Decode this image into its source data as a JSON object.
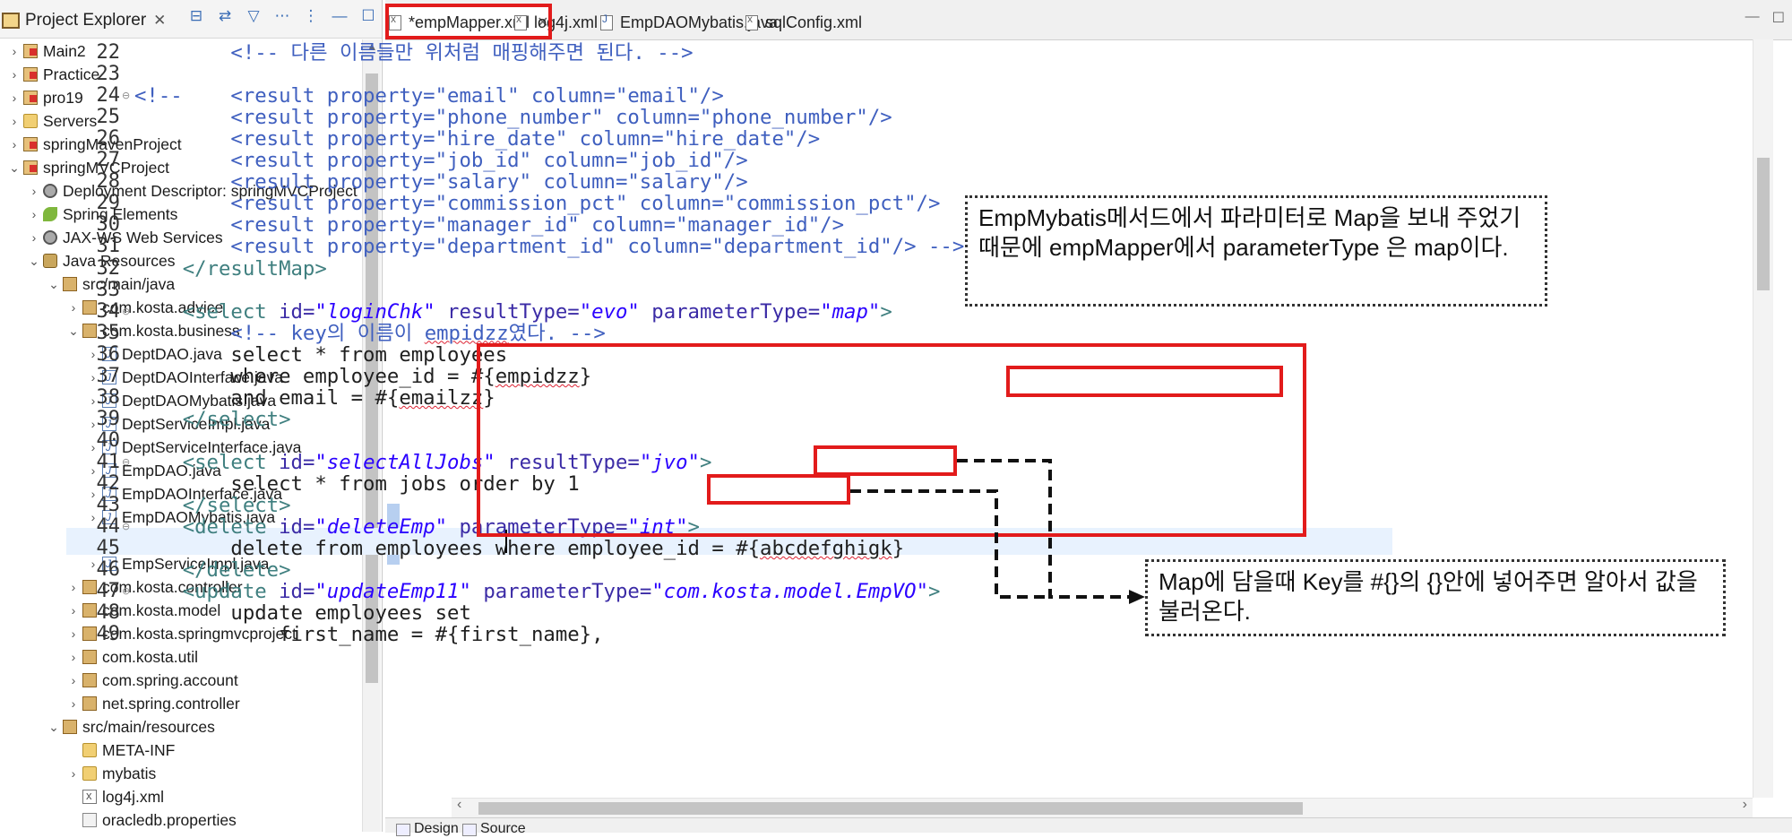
{
  "explorer": {
    "title": "Project Explorer",
    "close": "✕",
    "tools": [
      "⊟",
      "⇄",
      "▽",
      "⋯",
      "⋮",
      "—",
      "☐"
    ],
    "items": [
      {
        "label": "Main2",
        "level": 0,
        "arrow": "›",
        "icon": "project"
      },
      {
        "label": "Practice",
        "level": 0,
        "arrow": "›",
        "icon": "project"
      },
      {
        "label": "pro19",
        "level": 0,
        "arrow": "›",
        "icon": "project"
      },
      {
        "label": "Servers",
        "level": 0,
        "arrow": "›",
        "icon": "folder"
      },
      {
        "label": "springMavenProject",
        "level": 0,
        "arrow": "›",
        "icon": "project"
      },
      {
        "label": "springMVCProject",
        "level": 0,
        "arrow": "⌄",
        "icon": "project"
      },
      {
        "label": "Deployment Descriptor: springMVCProject",
        "level": 1,
        "arrow": "›",
        "icon": "gear"
      },
      {
        "label": "Spring Elements",
        "level": 1,
        "arrow": "›",
        "icon": "leaf"
      },
      {
        "label": "JAX-WS Web Services",
        "level": 1,
        "arrow": "›",
        "icon": "gear"
      },
      {
        "label": "Java Resources",
        "level": 1,
        "arrow": "⌄",
        "icon": "jar"
      },
      {
        "label": "src/main/java",
        "level": 2,
        "arrow": "⌄",
        "icon": "pkg"
      },
      {
        "label": "com.kosta.advice",
        "level": 3,
        "arrow": "›",
        "icon": "pkg"
      },
      {
        "label": "com.kosta.business",
        "level": 3,
        "arrow": "⌄",
        "icon": "pkg"
      },
      {
        "label": "DeptDAO.java",
        "level": 4,
        "arrow": "›",
        "icon": "java"
      },
      {
        "label": "DeptDAOInterface.java",
        "level": 4,
        "arrow": "›",
        "icon": "java"
      },
      {
        "label": "DeptDAOMybatis.java",
        "level": 4,
        "arrow": "›",
        "icon": "java"
      },
      {
        "label": "DeptServiceImpl.java",
        "level": 4,
        "arrow": "›",
        "icon": "java"
      },
      {
        "label": "DeptServiceInterface.java",
        "level": 4,
        "arrow": "›",
        "icon": "java"
      },
      {
        "label": "EmpDAO.java",
        "level": 4,
        "arrow": "›",
        "icon": "java"
      },
      {
        "label": "EmpDAOInterface.java",
        "level": 4,
        "arrow": "›",
        "icon": "java"
      },
      {
        "label": "EmpDAOMybatis.java",
        "level": 4,
        "arrow": "›",
        "icon": "java"
      },
      {
        "label": "EmpService.java",
        "level": 4,
        "arrow": "›",
        "icon": "java"
      },
      {
        "label": "EmpServiceImpl.java",
        "level": 4,
        "arrow": "›",
        "icon": "java"
      },
      {
        "label": "com.kosta.controller",
        "level": 3,
        "arrow": "›",
        "icon": "pkg"
      },
      {
        "label": "com.kosta.model",
        "level": 3,
        "arrow": "›",
        "icon": "pkg"
      },
      {
        "label": "com.kosta.springmvcproject",
        "level": 3,
        "arrow": "›",
        "icon": "pkg"
      },
      {
        "label": "com.kosta.util",
        "level": 3,
        "arrow": "›",
        "icon": "pkg"
      },
      {
        "label": "com.spring.account",
        "level": 3,
        "arrow": "›",
        "icon": "pkg"
      },
      {
        "label": "net.spring.controller",
        "level": 3,
        "arrow": "›",
        "icon": "pkg"
      },
      {
        "label": "src/main/resources",
        "level": 2,
        "arrow": "⌄",
        "icon": "pkg"
      },
      {
        "label": "META-INF",
        "level": 3,
        "arrow": "",
        "icon": "folder"
      },
      {
        "label": "mybatis",
        "level": 3,
        "arrow": "›",
        "icon": "folder"
      },
      {
        "label": "log4j.xml",
        "level": 3,
        "arrow": "",
        "icon": "xml"
      },
      {
        "label": "oracledb.properties",
        "level": 3,
        "arrow": "",
        "icon": "props"
      }
    ]
  },
  "editor": {
    "tabs": [
      {
        "label": "*empMapper.xml",
        "icon": "xml",
        "active": true,
        "close": "✕"
      },
      {
        "label": "log4j.xml",
        "icon": "xml",
        "active": false,
        "close": ""
      },
      {
        "label": "EmpDAOMybatis.java",
        "icon": "java",
        "active": false,
        "close": ""
      },
      {
        "label": "sqlConfig.xml",
        "icon": "xml",
        "active": false,
        "close": ""
      }
    ],
    "tab_controls": [
      "—",
      "☐"
    ],
    "bottom_tabs": [
      "Design",
      "Source"
    ],
    "lines": [
      {
        "n": "22",
        "fold": "",
        "segs": [
          [
            "cm",
            "        <!-- 다른 이름들만 위처럼 매핑해주면 된다. -->"
          ]
        ]
      },
      {
        "n": "23",
        "fold": "",
        "segs": []
      },
      {
        "n": "24",
        "fold": "⊖",
        "segs": [
          [
            "cm",
            "<!--    <result property=\"email\" column=\"email\"/>"
          ]
        ]
      },
      {
        "n": "25",
        "fold": "",
        "segs": [
          [
            "cm",
            "        <result property=\"phone_number\" column=\"phone_number\"/>"
          ]
        ]
      },
      {
        "n": "26",
        "fold": "",
        "segs": [
          [
            "cm",
            "        <result property=\"hire_date\" column=\"hire_date\"/>"
          ]
        ]
      },
      {
        "n": "27",
        "fold": "",
        "segs": [
          [
            "cm",
            "        <result property=\"job_id\" column=\"job_id\"/>"
          ]
        ]
      },
      {
        "n": "28",
        "fold": "",
        "segs": [
          [
            "cm",
            "        <result property=\"salary\" column=\"salary\"/>"
          ]
        ]
      },
      {
        "n": "29",
        "fold": "",
        "segs": [
          [
            "cm",
            "        <result property=\"commission_pct\" column=\"commission_pct\"/>"
          ]
        ]
      },
      {
        "n": "30",
        "fold": "",
        "segs": [
          [
            "cm",
            "        <result property=\"manager_id\" column=\"manager_id\"/>"
          ]
        ]
      },
      {
        "n": "31",
        "fold": "",
        "segs": [
          [
            "cm",
            "        <result property=\"department_id\" column=\"department_id\"/> -->"
          ]
        ]
      },
      {
        "n": "32",
        "fold": "",
        "segs": [
          [
            "tg",
            "    </resultMap>"
          ]
        ]
      },
      {
        "n": "33",
        "fold": "",
        "segs": []
      },
      {
        "n": "34",
        "fold": "⊖",
        "segs": [
          [
            "tg",
            "    <select "
          ],
          [
            "at",
            "id="
          ],
          [
            "sv",
            "\"loginChk\""
          ],
          [
            "at",
            " resultType="
          ],
          [
            "sv",
            "\"evo\""
          ],
          [
            "at",
            " parameterType="
          ],
          [
            "sv",
            "\"map\""
          ],
          [
            "tg",
            ">"
          ]
        ]
      },
      {
        "n": "35",
        "fold": "",
        "segs": [
          [
            "cm",
            "        <!-- key의 이름이 "
          ],
          [
            "cm sq",
            "empidzz"
          ],
          [
            "cm",
            "였다. -->"
          ]
        ]
      },
      {
        "n": "36",
        "fold": "",
        "segs": [
          [
            "",
            "        select * from employees"
          ]
        ]
      },
      {
        "n": "37",
        "fold": "",
        "segs": [
          [
            "",
            "        where employee_id = #{"
          ],
          [
            "sq",
            "empidzz"
          ],
          [
            "",
            "}"
          ]
        ]
      },
      {
        "n": "38",
        "fold": "",
        "segs": [
          [
            "",
            "        and email = #{"
          ],
          [
            "sq",
            "emailzz"
          ],
          [
            "",
            "}"
          ]
        ]
      },
      {
        "n": "39",
        "fold": "",
        "segs": [
          [
            "tg",
            "    </select>"
          ]
        ]
      },
      {
        "n": "40",
        "fold": "",
        "segs": []
      },
      {
        "n": "41",
        "fold": "⊖",
        "segs": [
          [
            "tg",
            "    <select "
          ],
          [
            "at",
            "id="
          ],
          [
            "sv",
            "\"selectAllJobs\""
          ],
          [
            "at",
            " resultType="
          ],
          [
            "sv",
            "\"jvo\""
          ],
          [
            "tg",
            ">"
          ]
        ]
      },
      {
        "n": "42",
        "fold": "",
        "segs": [
          [
            "",
            "        select * from jobs order by 1"
          ]
        ]
      },
      {
        "n": "43",
        "fold": "",
        "segs": [
          [
            "tg",
            "    </select>"
          ]
        ]
      },
      {
        "n": "44",
        "fold": "⊖",
        "segs": [
          [
            "tg",
            "    <delete "
          ],
          [
            "at",
            "id="
          ],
          [
            "sv",
            "\"deleteEmp\""
          ],
          [
            "at",
            " parameterType="
          ],
          [
            "sv",
            "\"int\""
          ],
          [
            "tg",
            ">"
          ]
        ]
      },
      {
        "n": "45",
        "fold": "",
        "segs": [
          [
            "",
            "        delete from employees where employee_id = #{"
          ],
          [
            "sq",
            "abcdefghigk"
          ],
          [
            "",
            "}"
          ]
        ]
      },
      {
        "n": "46",
        "fold": "",
        "segs": [
          [
            "tg",
            "    </delete>"
          ]
        ]
      },
      {
        "n": "47",
        "fold": "⊖",
        "segs": [
          [
            "tg",
            "    <update "
          ],
          [
            "at",
            "id="
          ],
          [
            "sv",
            "\"updateEmp11\""
          ],
          [
            "at",
            " parameterType="
          ],
          [
            "sv",
            "\"com.kosta.model.EmpVO\""
          ],
          [
            "tg",
            ">"
          ]
        ]
      },
      {
        "n": "48",
        "fold": "",
        "segs": [
          [
            "",
            "        update employees set"
          ]
        ]
      },
      {
        "n": "49",
        "fold": "",
        "segs": [
          [
            "",
            "            first_name = #{first_name},"
          ]
        ]
      }
    ]
  },
  "annotations": {
    "callout_top": "EmpMybatis메서드에서 파라미터로 Map을 보내 주었기 때문에 empMapper에서 parameterType 은 map이다.",
    "callout_bottom": "Map에 담을때 Key를 #{}의 {}안에 넣어주면 알아서 값을 불러온다.",
    "box_color": "#e21b1b"
  }
}
